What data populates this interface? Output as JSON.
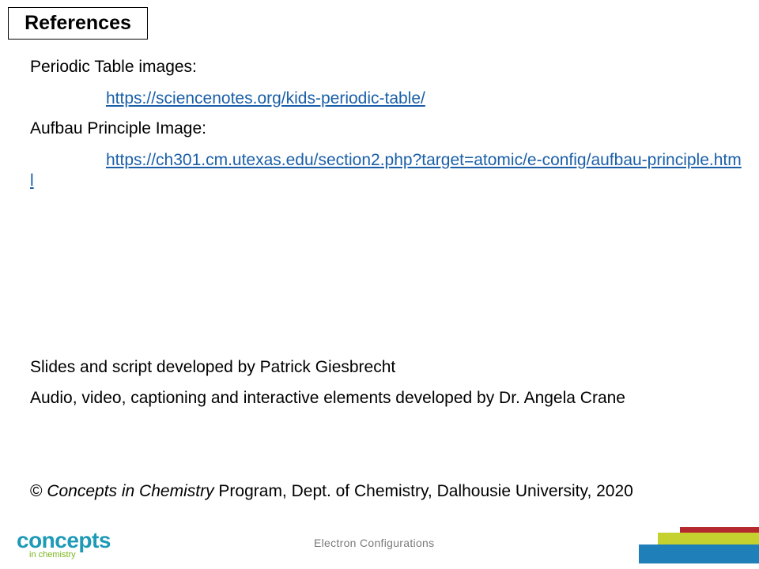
{
  "title": "References",
  "sections": {
    "periodic_label": "Periodic Table images:",
    "periodic_link": "https://sciencenotes.org/kids-periodic-table/",
    "aufbau_label": "Aufbau Principle Image:",
    "aufbau_link": "https://ch301.cm.utexas.edu/section2.php?target=atomic/e-config/aufbau-principle.html"
  },
  "credits": {
    "slides": "Slides and script developed by Patrick Giesbrecht",
    "audio": "Audio, video, captioning and interactive elements developed by Dr. Angela Crane"
  },
  "copyright": {
    "symbol": "©",
    "program_name": "Concepts in Chemistry",
    "rest": " Program, Dept. of Chemistry, Dalhousie University, 2020"
  },
  "footer": {
    "slide_title": "Electron Configurations",
    "logo_main": "concepts",
    "logo_sub": "in chemistry"
  },
  "colors": {
    "link": "#1a5fa8",
    "bar_red": "#b5282d",
    "bar_green": "#c5d12f",
    "bar_blue": "#1f7fb8",
    "logo_blue": "#1e9ab7",
    "logo_green": "#7ab51d"
  }
}
